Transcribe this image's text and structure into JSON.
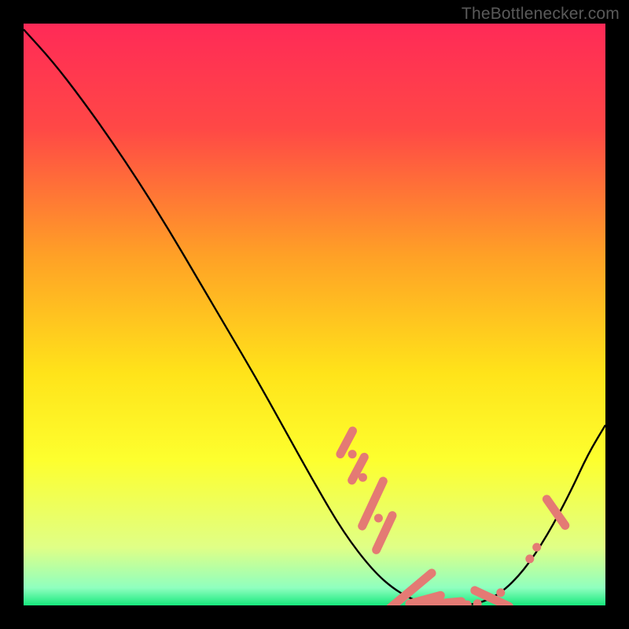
{
  "watermark": "TheBottlenecker.com",
  "chart_data": {
    "type": "line",
    "title": "",
    "xlabel": "",
    "ylabel": "",
    "xlim": [
      0,
      100
    ],
    "ylim": [
      0,
      100
    ],
    "background_gradient": {
      "stops": [
        {
          "offset": 0,
          "color": "#ff2a57"
        },
        {
          "offset": 18,
          "color": "#ff4846"
        },
        {
          "offset": 40,
          "color": "#ffa126"
        },
        {
          "offset": 60,
          "color": "#ffe31a"
        },
        {
          "offset": 75,
          "color": "#fdff2e"
        },
        {
          "offset": 90,
          "color": "#e0ff86"
        },
        {
          "offset": 97,
          "color": "#8fffbf"
        },
        {
          "offset": 100,
          "color": "#17e87c"
        }
      ]
    },
    "curve": {
      "description": "V-shaped bottleneck curve",
      "x": [
        0,
        5,
        10,
        15,
        20,
        25,
        30,
        35,
        40,
        45,
        50,
        55,
        60,
        64,
        68,
        71,
        74,
        78,
        82,
        86,
        90,
        94,
        97,
        100
      ],
      "y": [
        99,
        93.5,
        87,
        80,
        72.5,
        64.5,
        56,
        47.5,
        39,
        30,
        21,
        12.5,
        6,
        2.5,
        0.5,
        0,
        0,
        0.2,
        2,
        6,
        12,
        19.5,
        26,
        31
      ]
    },
    "highlighted_points": [
      {
        "x": 55.5,
        "y": 28.0,
        "shape": "pill",
        "angle": -62,
        "len": 6
      },
      {
        "x": 56.5,
        "y": 26.0,
        "shape": "dot"
      },
      {
        "x": 57.5,
        "y": 23.5,
        "shape": "pill",
        "angle": -62,
        "len": 6
      },
      {
        "x": 58.3,
        "y": 22.0,
        "shape": "dot"
      },
      {
        "x": 60.0,
        "y": 17.5,
        "shape": "pill",
        "angle": -65,
        "len": 10
      },
      {
        "x": 61.0,
        "y": 15.0,
        "shape": "dot"
      },
      {
        "x": 62.0,
        "y": 12.5,
        "shape": "pill",
        "angle": -65,
        "len": 8
      },
      {
        "x": 66.5,
        "y": 2.5,
        "shape": "pill",
        "angle": -40,
        "len": 11
      },
      {
        "x": 69.0,
        "y": 1.0,
        "shape": "pill",
        "angle": -15,
        "len": 7
      },
      {
        "x": 71.0,
        "y": 0.3,
        "shape": "pill",
        "angle": -5,
        "len": 10
      },
      {
        "x": 73.5,
        "y": 0.1,
        "shape": "pill",
        "angle": 0,
        "len": 7
      },
      {
        "x": 76.0,
        "y": 0.1,
        "shape": "dot"
      },
      {
        "x": 78.0,
        "y": 0.3,
        "shape": "dot"
      },
      {
        "x": 80.5,
        "y": 1.2,
        "shape": "pill",
        "angle": 25,
        "len": 8
      },
      {
        "x": 82.0,
        "y": 2.2,
        "shape": "dot"
      },
      {
        "x": 87.0,
        "y": 8.0,
        "shape": "dot"
      },
      {
        "x": 88.2,
        "y": 10.0,
        "shape": "dot"
      },
      {
        "x": 91.5,
        "y": 16.0,
        "shape": "pill",
        "angle": 55,
        "len": 7
      }
    ],
    "marker_color": "#e47a74",
    "curve_color": "#000000"
  }
}
